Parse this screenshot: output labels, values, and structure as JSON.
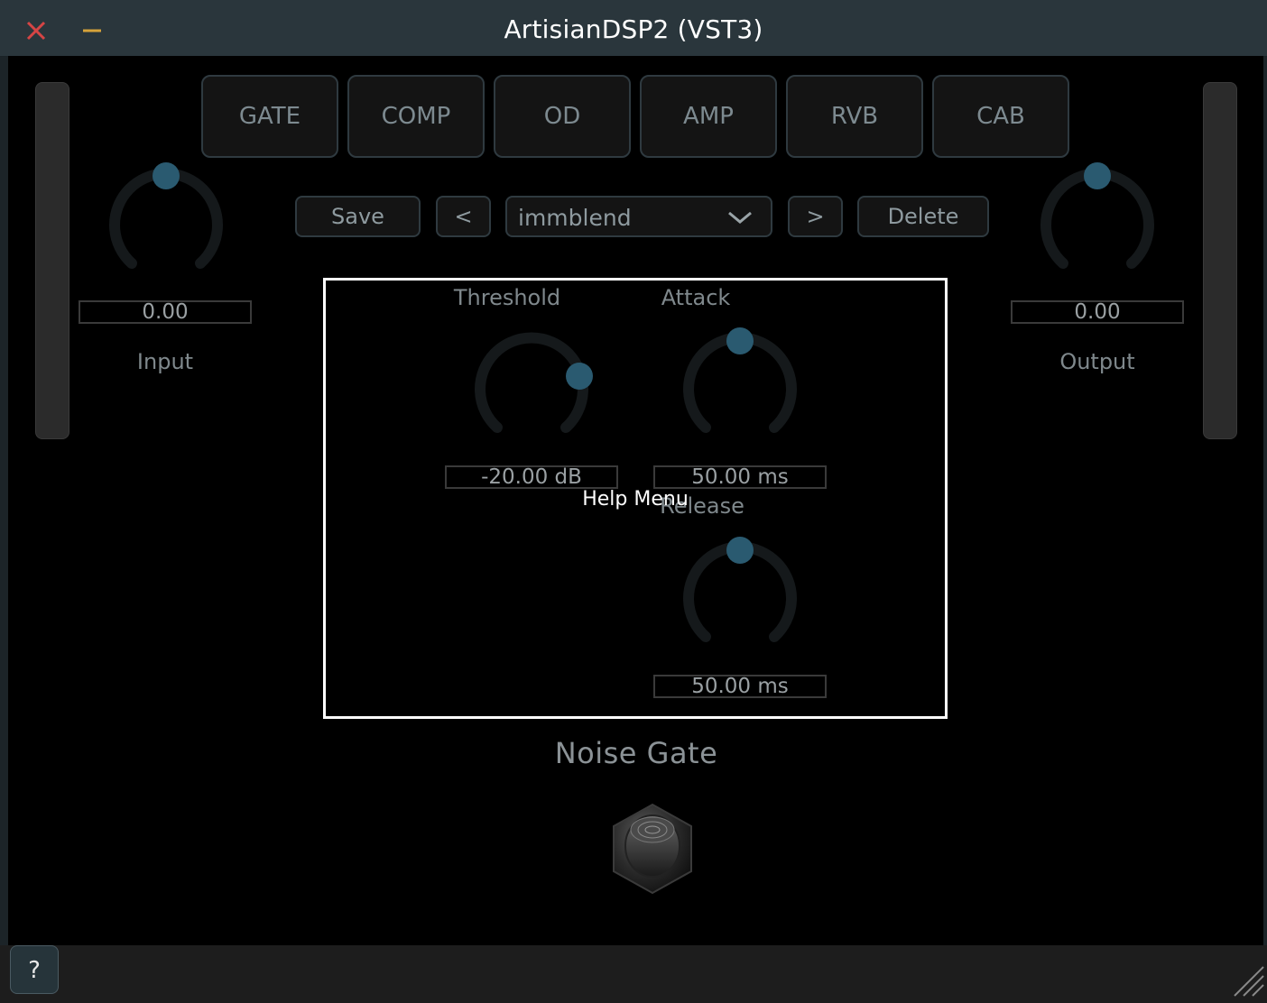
{
  "window": {
    "title": "ArtisianDSP2 (VST3)",
    "close_icon": "close-icon",
    "minimize_icon": "minimize-icon",
    "close_color": "#d64545",
    "minimize_color": "#d6a33a"
  },
  "tabs": [
    "GATE",
    "COMP",
    "OD",
    "AMP",
    "RVB",
    "CAB"
  ],
  "presets": {
    "save_label": "Save",
    "prev_label": "<",
    "selected": "immblend",
    "next_label": ">",
    "delete_label": "Delete"
  },
  "input": {
    "value": "0.00",
    "label": "Input"
  },
  "output": {
    "value": "0.00",
    "label": "Output"
  },
  "gate": {
    "threshold": {
      "label": "Threshold",
      "value": "-20.00 dB"
    },
    "attack": {
      "label": "Attack",
      "value": "50.00 ms"
    },
    "release": {
      "label": "Release",
      "value": "50.00 ms"
    },
    "title": "Noise Gate"
  },
  "help": {
    "overlay_text": "Help Menu",
    "button_label": "?"
  },
  "colors": {
    "knob_indicator": "#2a5a70",
    "knob_track": "#15191b"
  }
}
